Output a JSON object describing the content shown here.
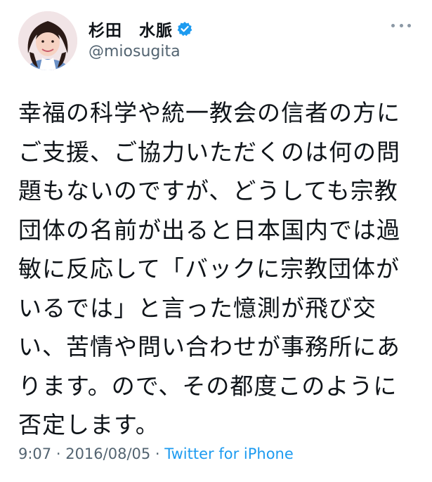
{
  "user": {
    "display_name": "杉田　水脈",
    "handle": "@miosugita",
    "verified": true,
    "verified_color": "#1d9bf0"
  },
  "tweet": {
    "lines": [
      "幸福の科学や統一教会の信者の方に",
      "ご支援、ご協力いただくのは何の問",
      "題もないのですが、どうしても宗教",
      "団体の名前が出ると日本国内では過",
      "敏に反応して「バックに宗教団体が",
      "いるでは」と言った憶測が飛び交",
      "い、苦情や問い合わせが事務所にあ",
      "ります。ので、その都度このように",
      "否定します。"
    ],
    "time": "9:07",
    "separator": " · ",
    "date": "2016/08/05",
    "source": "Twitter for iPhone"
  },
  "icons": {
    "more": "more-dots-icon",
    "verified": "verified-badge-icon"
  }
}
